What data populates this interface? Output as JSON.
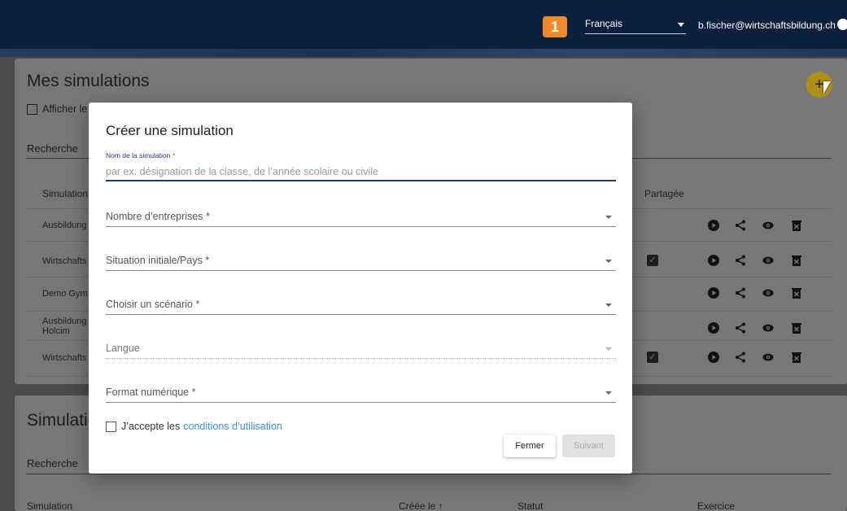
{
  "topbar": {
    "badge": "1",
    "language": "Français",
    "user_email": "b.fischer@wirtschaftsbildung.ch"
  },
  "my_simulations": {
    "title": "Mes simulations",
    "show_checkbox_label": "Afficher le",
    "search_label": "Recherche",
    "col_simulation": "Simulation",
    "col_shared": "Partagée",
    "rows": [
      {
        "name": "Ausbildung",
        "shared": false
      },
      {
        "name": "Wirtschafts",
        "shared": true
      },
      {
        "name": "Demo Gym",
        "shared": false
      },
      {
        "name": "Ausbildung Holcim",
        "shared": false
      },
      {
        "name": "Wirtschafts",
        "shared": true
      }
    ],
    "fab_label": "+"
  },
  "other_simulations": {
    "title": "Simulatic",
    "search_label": "Recherche",
    "col_simulation": "Simulation",
    "col_created": "Créée le ↑",
    "col_status": "Statut",
    "col_exercise": "Exercice"
  },
  "modal": {
    "title": "Créer une simulation",
    "name_label": "Nom de la simulation",
    "required_mark": "*",
    "name_placeholder": "par ex. désignation de la classe, de l’année scolaire ou civile",
    "name_value": "",
    "fields": [
      {
        "label": "Nombre d’entreprises *",
        "disabled": false
      },
      {
        "label": "Situation initiale/Pays *",
        "disabled": false
      },
      {
        "label": "Choisir un scénario *",
        "disabled": false
      },
      {
        "label": "Langue",
        "disabled": true
      },
      {
        "label": "Format numérique *",
        "disabled": false
      }
    ],
    "terms_prefix": "J’accepte les",
    "terms_link": "conditions d’utilisation",
    "close_label": "Fermer",
    "next_label": "Suivant"
  }
}
